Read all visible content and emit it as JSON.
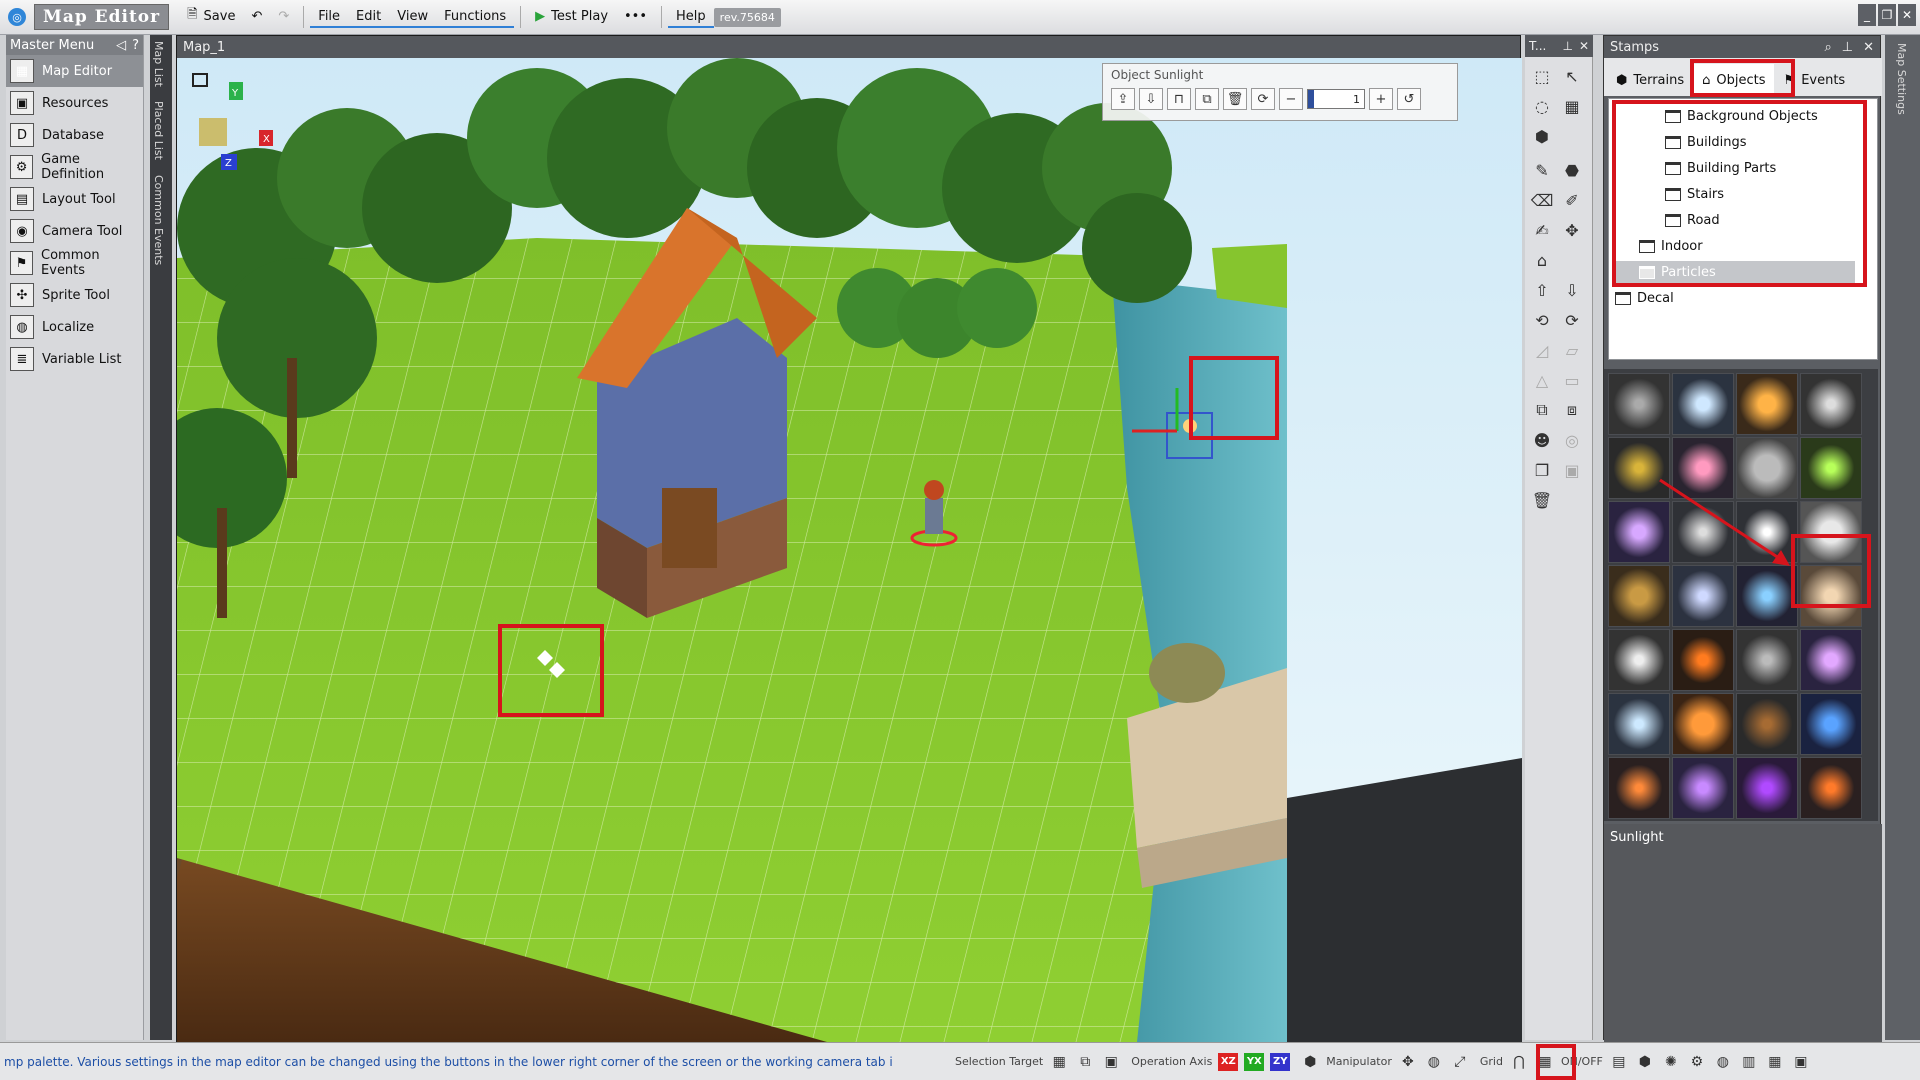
{
  "titlebar": {
    "app_title": "Map Editor",
    "save_label": "Save",
    "menu": [
      "File",
      "Edit",
      "View",
      "Functions"
    ],
    "test_play_label": "Test Play",
    "more_label": "•••",
    "help_label": "Help",
    "revision": "rev.75684"
  },
  "master_menu": {
    "title": "Master Menu",
    "collapse_label": "◁",
    "help_label": "?",
    "items": [
      {
        "label": "Map Editor",
        "icon": "map-icon",
        "active": true
      },
      {
        "label": "Resources",
        "icon": "resources-icon"
      },
      {
        "label": "Database",
        "icon": "database-icon"
      },
      {
        "label": "Game Definition",
        "icon": "gear-icon"
      },
      {
        "label": "Layout Tool",
        "icon": "layout-icon"
      },
      {
        "label": "Camera Tool",
        "icon": "camera-icon"
      },
      {
        "label": "Common Events",
        "icon": "events-icon"
      },
      {
        "label": "Sprite Tool",
        "icon": "sprite-icon"
      },
      {
        "label": "Localize",
        "icon": "globe-icon"
      },
      {
        "label": "Variable List",
        "icon": "variable-icon"
      }
    ]
  },
  "side_tabs": {
    "map_list": "Map List",
    "placed_list": "Placed List",
    "common_events": "Common Events"
  },
  "viewport": {
    "title": "Map_1",
    "axis_labels": {
      "x": "X",
      "y": "Y",
      "z": "Z"
    },
    "object_panel": {
      "title": "Object Sunlight",
      "value": "1"
    }
  },
  "tools_panel": {
    "title": "T...",
    "pin_label": "⊥",
    "close_label": "✕"
  },
  "stamps": {
    "title": "Stamps",
    "tabs": [
      {
        "label": "Terrains",
        "active": false
      },
      {
        "label": "Objects",
        "active": true
      },
      {
        "label": "Events",
        "active": false
      }
    ],
    "tree": [
      {
        "label": "Background Objects",
        "level": 2
      },
      {
        "label": "Buildings",
        "level": 2
      },
      {
        "label": "Building Parts",
        "level": 2
      },
      {
        "label": "Stairs",
        "level": 2
      },
      {
        "label": "Road",
        "level": 2
      },
      {
        "label": "Indoor",
        "level": 1
      },
      {
        "label": "Particles",
        "level": 1,
        "selected": true
      },
      {
        "label": "Decal",
        "level": 0
      }
    ],
    "selected_description": "Sunlight"
  },
  "right_tab": {
    "label": "Map Settings"
  },
  "status_bar": {
    "message": "mp palette.   Various settings in the map editor can be changed using the buttons in the lower right corner of the screen or the working camera tab i",
    "selection_target": "Selection Target",
    "operation_axis": "Operation Axis",
    "axes": [
      "XZ",
      "YX",
      "ZY"
    ],
    "manipulator": "Manipulator",
    "grid": "Grid",
    "onoff": "ON/OFF"
  },
  "colors": {
    "highlight": "#d6141c",
    "accent": "#2f7fd6",
    "panel_dark": "#55585d"
  }
}
